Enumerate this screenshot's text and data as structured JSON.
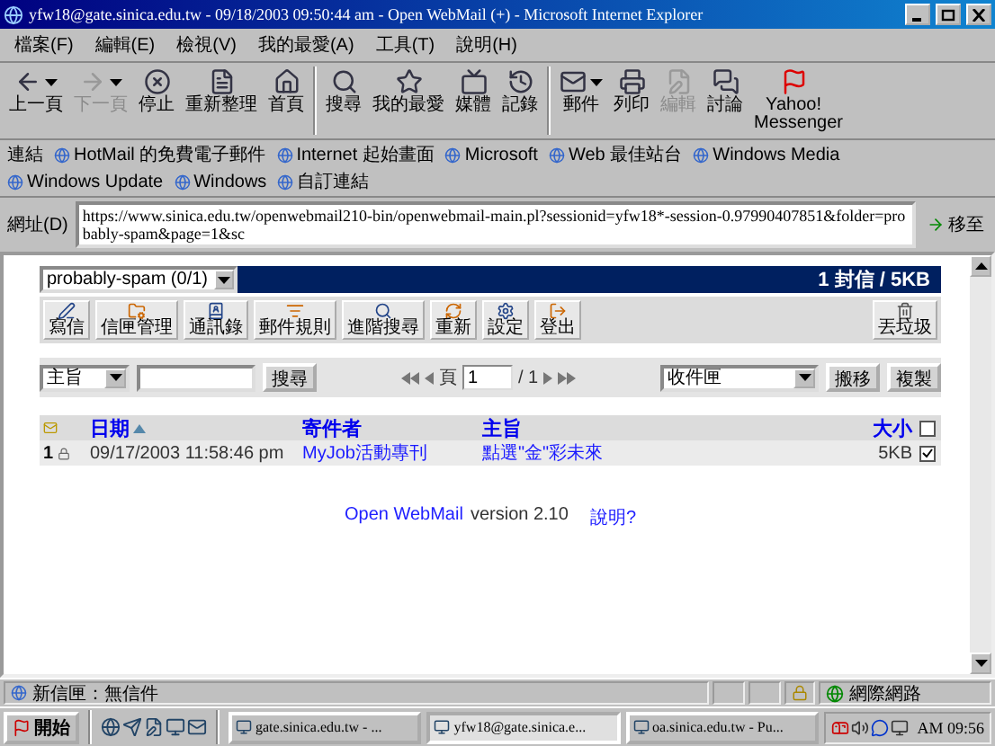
{
  "window": {
    "title": "yfw18@gate.sinica.edu.tw - 09/18/2003 09:50:44 am - Open WebMail (+) - Microsoft Internet Explorer"
  },
  "menu": [
    "檔案(F)",
    "編輯(E)",
    "檢視(V)",
    "我的最愛(A)",
    "工具(T)",
    "說明(H)"
  ],
  "toolbar": [
    {
      "label": "上一頁",
      "disabled": false,
      "dropdown": true
    },
    {
      "label": "下一頁",
      "disabled": true,
      "dropdown": true
    },
    {
      "label": "停止",
      "disabled": false,
      "dropdown": false
    },
    {
      "label": "重新整理",
      "disabled": false,
      "dropdown": false
    },
    {
      "label": "首頁",
      "disabled": false,
      "dropdown": false
    },
    {
      "label": "搜尋",
      "disabled": false,
      "dropdown": false
    },
    {
      "label": "我的最愛",
      "disabled": false,
      "dropdown": false
    },
    {
      "label": "媒體",
      "disabled": false,
      "dropdown": false
    },
    {
      "label": "記錄",
      "disabled": false,
      "dropdown": false
    },
    {
      "label": "郵件",
      "disabled": false,
      "dropdown": true
    },
    {
      "label": "列印",
      "disabled": false,
      "dropdown": false
    },
    {
      "label": "編輯",
      "disabled": true,
      "dropdown": false
    },
    {
      "label": "討論",
      "disabled": false,
      "dropdown": false
    },
    {
      "label": "Yahoo! Messenger",
      "disabled": false,
      "dropdown": false
    }
  ],
  "links": {
    "label": "連結",
    "items": [
      "HotMail 的免費電子郵件",
      "Internet 起始畫面",
      "Microsoft",
      "Web 最佳站台",
      "Windows Media",
      "Windows Update",
      "Windows",
      "自訂連結"
    ]
  },
  "address": {
    "label": "網址(D)",
    "value": "https://www.sinica.edu.tw/openwebmail210-bin/openwebmail-main.pl?sessionid=yfw18*-session-0.97990407851&folder=probably-spam&page=1&sc",
    "go": "移至"
  },
  "webmail": {
    "folder": "probably-spam (0/1)",
    "summary": "1 封信 / 5KB",
    "actions": [
      "寫信",
      "信匣管理",
      "通訊錄",
      "郵件規則",
      "進階搜尋",
      "重新",
      "設定",
      "登出"
    ],
    "trash": "丟垃圾",
    "search": {
      "field": "主旨",
      "button": "搜尋"
    },
    "pager": {
      "page_label": "頁",
      "page": "1",
      "total": "/ 1"
    },
    "move": {
      "folder": "收件匣",
      "buttons": [
        "搬移",
        "複製"
      ]
    },
    "columns": [
      {
        "label": "日期",
        "sorted": true
      },
      {
        "label": "寄件者",
        "sorted": false
      },
      {
        "label": "主旨",
        "sorted": false
      },
      {
        "label": "大小",
        "sorted": false
      }
    ],
    "all_checked": false,
    "rows": [
      {
        "number": "1",
        "date": "09/17/2003 11:58:46 pm",
        "sender": "MyJob活動專刊",
        "subject": "點選\"金\"彩未來",
        "size": "5KB",
        "checked": true
      }
    ],
    "footer": {
      "brand": "Open WebMail",
      "version": "version 2.10",
      "help": "說明?"
    }
  },
  "status_bar": {
    "text": "新信匣：無信件",
    "zone": "網際網路"
  },
  "taskbar": {
    "start": "開始",
    "tasks": [
      {
        "label": "gate.sinica.edu.tw - ...",
        "selected": false
      },
      {
        "label": "yfw18@gate.sinica.e...",
        "selected": true
      },
      {
        "label": "oa.sinica.edu.tw - Pu...",
        "selected": false
      }
    ],
    "clock": "AM 09:56"
  }
}
